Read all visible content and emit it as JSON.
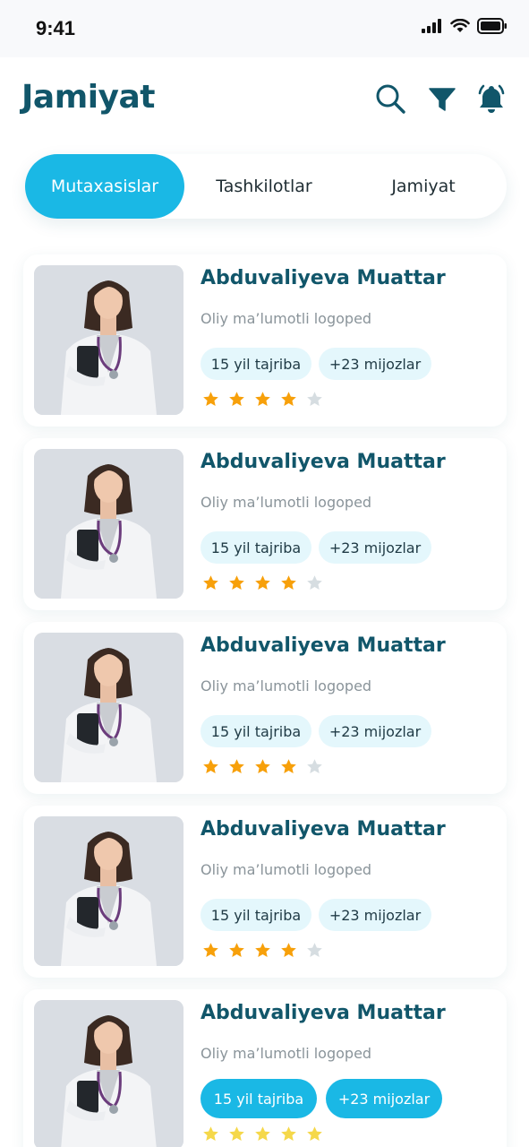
{
  "status": {
    "time": "9:41"
  },
  "header": {
    "title": "Jamiyat"
  },
  "tabs": [
    {
      "label": "Mutaxasislar",
      "active": true
    },
    {
      "label": "Tashkilotlar",
      "active": false
    },
    {
      "label": "Jamiyat",
      "active": false
    }
  ],
  "cards": [
    {
      "name": "Abduvaliyeva Muattar",
      "subtitle": "Oliy ma’lumotli logoped",
      "experience": "15 yil tajriba",
      "clients": "+23 mijozlar",
      "rating": 4,
      "max_rating": 5
    },
    {
      "name": "Abduvaliyeva Muattar",
      "subtitle": "Oliy ma’lumotli logoped",
      "experience": "15 yil tajriba",
      "clients": "+23 mijozlar",
      "rating": 4,
      "max_rating": 5
    },
    {
      "name": "Abduvaliyeva Muattar",
      "subtitle": "Oliy ma’lumotli logoped",
      "experience": "15 yil tajriba",
      "clients": "+23 mijozlar",
      "rating": 4,
      "max_rating": 5
    },
    {
      "name": "Abduvaliyeva Muattar",
      "subtitle": "Oliy ma’lumotli logoped",
      "experience": "15 yil tajriba",
      "clients": "+23 mijozlar",
      "rating": 4,
      "max_rating": 5
    },
    {
      "name": "Abduvaliyeva Muattar",
      "subtitle": "Oliy ma’lumotli logoped",
      "experience": "15 yil tajriba",
      "clients": "+23 mijozlar",
      "rating": 5,
      "max_rating": 5
    }
  ],
  "colors": {
    "brand_dark": "#11566a",
    "accent": "#1ab8e5",
    "pill_bg": "#e4f7fc",
    "star_filled": "#f7a00a",
    "star_empty": "#d6dde1",
    "star_last_card": "#f5d84a"
  },
  "icons": {
    "search": "search-icon",
    "filter": "filter-icon",
    "notifications": "bell-icon"
  }
}
